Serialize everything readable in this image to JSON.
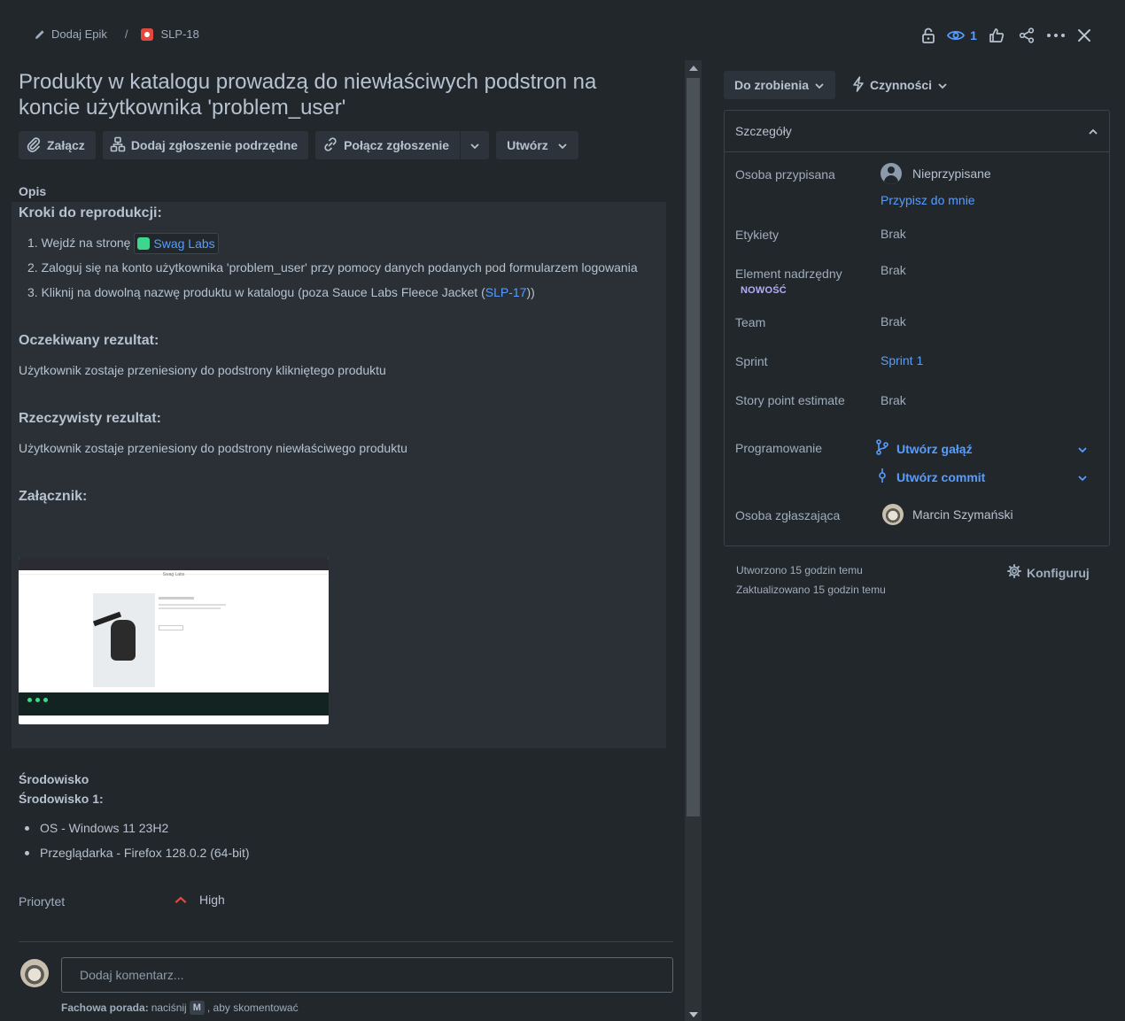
{
  "breadcrumb": {
    "epic_label": "Dodaj Epik",
    "separator": "/",
    "issue_key": "SLP-18"
  },
  "top_actions": {
    "watch_count": "1"
  },
  "issue": {
    "title": "Produkty w katalogu prowadzą do niewłaściwych podstron na koncie użytkownika 'problem_user'"
  },
  "toolbar": {
    "attach": "Załącz",
    "add_child": "Dodaj zgłoszenie podrzędne",
    "link_issue": "Połącz zgłoszenie",
    "create": "Utwórz"
  },
  "description": {
    "label": "Opis",
    "steps_heading": "Kroki do reprodukcji:",
    "step1_prefix": "1. Wejdź na stronę",
    "step1_link": "Swag Labs",
    "step2": "2. Zaloguj się na konto użytkownika 'problem_user' przy pomocy danych podanych pod formularzem logowania",
    "step3_prefix": "3. Kliknij na dowolną nazwę produktu w katalogu (poza Sauce Labs Fleece Jacket (",
    "step3_link": "SLP-17",
    "step3_suffix": "))",
    "expected_heading": "Oczekiwany rezultat:",
    "expected_text": "Użytkownik zostaje przeniesiony do podstrony klikniętego produktu",
    "actual_heading": "Rzeczywisty rezultat:",
    "actual_text": "Użytkownik zostaje przeniesiony do podstrony niewłaściwego produktu",
    "attachment_heading": "Załącznik:",
    "attachment_thumb_title": "Swag Labs"
  },
  "environment": {
    "label": "Środowisko",
    "sub": "Środowisko 1:",
    "items": [
      "OS - Windows 11 23H2",
      "Przeglądarka - Firefox 128.0.2 (64-bit)"
    ]
  },
  "priority": {
    "label": "Priorytet",
    "value": "High"
  },
  "comment": {
    "placeholder": "Dodaj komentarz...",
    "tip_bold": "Fachowa porada:",
    "tip_text1": "naciśnij",
    "tip_key": "M",
    "tip_text2": ", aby skomentować"
  },
  "sidebar": {
    "status_button": "Do zrobienia",
    "actions_button": "Czynności",
    "details_title": "Szczegóły",
    "assignee_label": "Osoba przypisana",
    "assignee_value": "Nieprzypisane",
    "assign_to_me": "Przypisz do mnie",
    "labels_label": "Etykiety",
    "labels_value": "Brak",
    "parent_label": "Element nadrzędny",
    "parent_badge": "NOWOŚĆ",
    "parent_value": "Brak",
    "team_label": "Team",
    "team_value": "Brak",
    "sprint_label": "Sprint",
    "sprint_value": "Sprint 1",
    "story_label": "Story point estimate",
    "story_value": "Brak",
    "dev_label": "Programowanie",
    "create_branch": "Utwórz gałąź",
    "create_commit": "Utwórz commit",
    "reporter_label": "Osoba zgłaszająca",
    "reporter_value": "Marcin Szymański",
    "created": "Utworzono 15 godzin temu",
    "updated": "Zaktualizowano 15 godzin temu",
    "configure": "Konfiguruj"
  },
  "colors": {
    "background": "#22272b",
    "link": "#579dff",
    "priority_high": "#e2483d",
    "new_badge": "#b8acf6"
  }
}
